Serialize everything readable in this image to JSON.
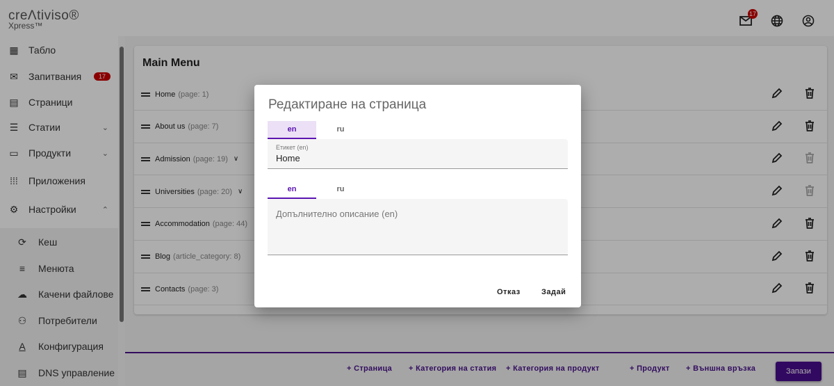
{
  "header": {
    "logo_line1": "creΛtiviso®",
    "logo_line2": "Xpress™",
    "mail_badge": "17"
  },
  "sidebar": {
    "items": [
      {
        "label": "Табло",
        "icon": "dashboard-icon"
      },
      {
        "label": "Запитвания",
        "icon": "mail-icon",
        "badge": "17"
      },
      {
        "label": "Страници",
        "icon": "pages-icon"
      },
      {
        "label": "Статии",
        "icon": "article-icon",
        "expand": "⌄"
      },
      {
        "label": "Продукти",
        "icon": "archive-icon",
        "expand": "⌄"
      },
      {
        "label": "Приложения",
        "icon": "apps-icon"
      },
      {
        "label": "Настройки",
        "icon": "gear-icon",
        "expand": "⌃"
      }
    ],
    "subitems": [
      {
        "label": "Кеш",
        "icon": "refresh-icon"
      },
      {
        "label": "Менюта",
        "icon": "menu-icon"
      },
      {
        "label": "Качени файлове",
        "icon": "cloud-upload-icon"
      },
      {
        "label": "Потребители",
        "icon": "user-icon"
      },
      {
        "label": "Конфигурация",
        "icon": "text-format-icon"
      },
      {
        "label": "DNS управление",
        "icon": "dns-icon"
      }
    ]
  },
  "card": {
    "title": "Main Menu",
    "rows": [
      {
        "label": "Home",
        "meta": "(page: 1)",
        "expandable": false,
        "delete_enabled": true
      },
      {
        "label": "About us",
        "meta": "(page: 7)",
        "expandable": false,
        "delete_enabled": true
      },
      {
        "label": "Admission",
        "meta": "(page: 19)",
        "expandable": true,
        "delete_enabled": false
      },
      {
        "label": "Universities",
        "meta": "(page: 20)",
        "expandable": true,
        "delete_enabled": false
      },
      {
        "label": "Accommodation",
        "meta": "(page: 44)",
        "expandable": false,
        "delete_enabled": true
      },
      {
        "label": "Blog",
        "meta": "(article_category: 8)",
        "expandable": false,
        "delete_enabled": true
      },
      {
        "label": "Contacts",
        "meta": "(page: 3)",
        "expandable": false,
        "delete_enabled": true
      }
    ]
  },
  "footer": {
    "buttons": [
      "+ Страница",
      "+ Категория на статия",
      "+ Категория на продукт",
      "+ Продукт",
      "+ Външна връзка"
    ],
    "save": "Запази"
  },
  "dialog": {
    "title": "Редактиране на страница",
    "tabs1": [
      "en",
      "ru"
    ],
    "label_field": {
      "label": "Етикет (en)",
      "value": "Home"
    },
    "tabs2": [
      "en",
      "ru"
    ],
    "description_placeholder": "Допълнително описание (en)",
    "cancel": "Отказ",
    "submit": "Задай"
  },
  "colors": {
    "accent": "#4a148c",
    "badge": "#cc0000"
  }
}
